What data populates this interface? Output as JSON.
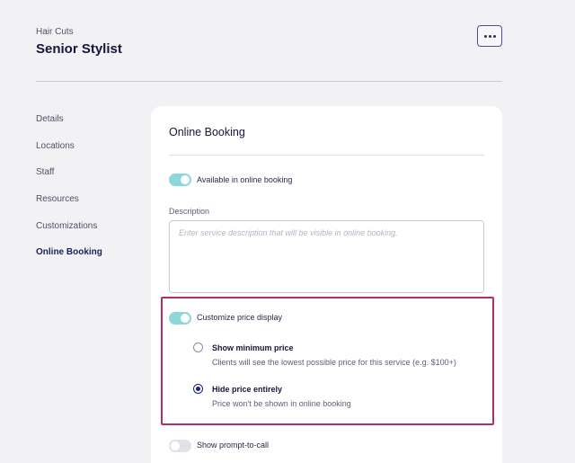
{
  "header": {
    "category": "Hair Cuts",
    "title": "Senior Stylist",
    "more_icon": "more-horizontal-icon"
  },
  "sidebar": {
    "items": [
      {
        "label": "Details",
        "active": false
      },
      {
        "label": "Locations",
        "active": false
      },
      {
        "label": "Staff",
        "active": false
      },
      {
        "label": "Resources",
        "active": false
      },
      {
        "label": "Customizations",
        "active": false
      },
      {
        "label": "Online Booking",
        "active": true
      }
    ]
  },
  "card": {
    "title": "Online Booking",
    "available_toggle": {
      "label": "Available in online booking",
      "on": true
    },
    "description": {
      "label": "Description",
      "value": "",
      "placeholder": "Enter service description that will be visible in online booking."
    },
    "price_toggle": {
      "label": "Customize price display",
      "on": true
    },
    "price_options": [
      {
        "title": "Show minimum price",
        "desc": "Clients will see the lowest possible price for this service (e.g. $100+)",
        "selected": false
      },
      {
        "title": "Hide price entirely",
        "desc": "Price won't be shown in online booking",
        "selected": true
      }
    ],
    "prompt_toggle": {
      "label": "Show prompt-to-call",
      "on": false
    }
  },
  "colors": {
    "accent": "#1b1f7a",
    "toggle_on": "#8dd6da",
    "highlight": "#b22d6a"
  }
}
